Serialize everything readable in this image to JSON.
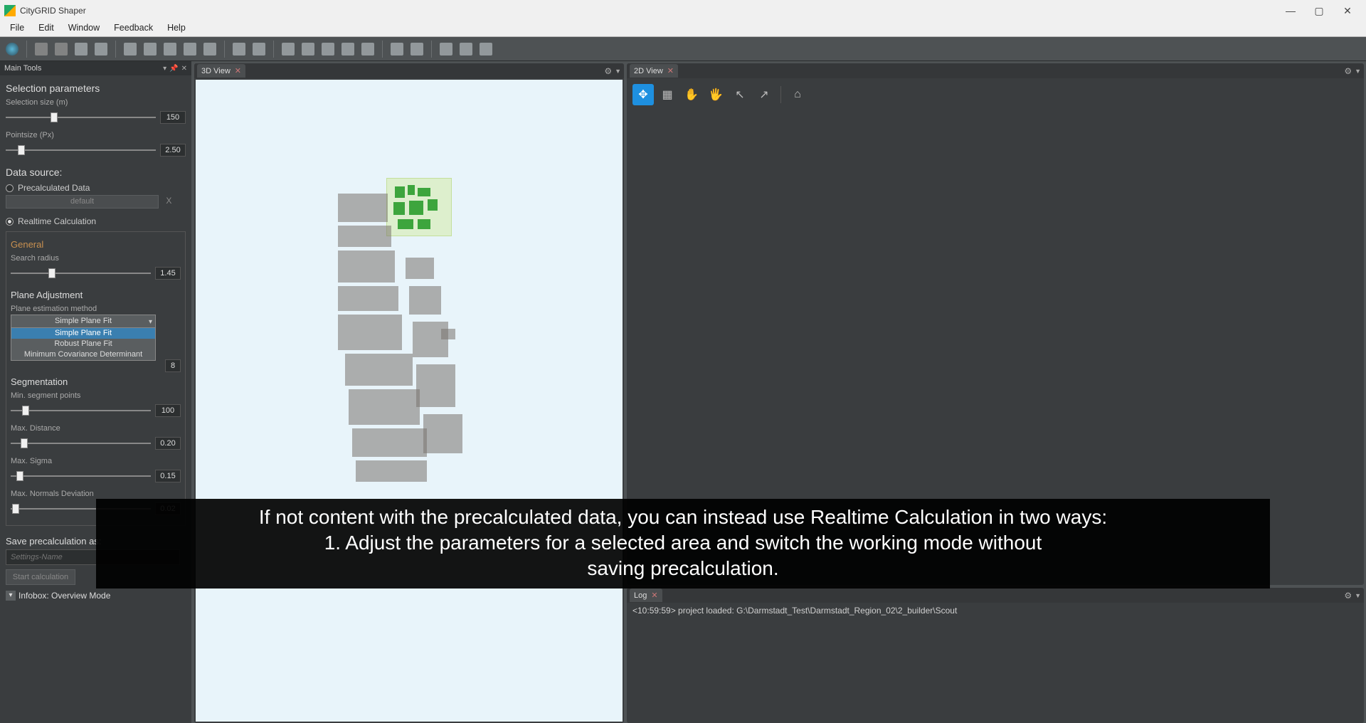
{
  "app": {
    "title": "CityGRID Shaper"
  },
  "menu": [
    "File",
    "Edit",
    "Window",
    "Feedback",
    "Help"
  ],
  "panel": {
    "title": "Main Tools",
    "selection_params": {
      "heading": "Selection parameters",
      "size_label": "Selection size (m)",
      "size_value": "150",
      "pointsize_label": "Pointsize (Px)",
      "pointsize_value": "2.50"
    },
    "data_source": {
      "heading": "Data source:",
      "precalc_label": "Precalculated Data",
      "precalc_combo": "default",
      "precalc_clear": "X",
      "realtime_label": "Realtime Calculation"
    },
    "general": {
      "heading": "General",
      "search_radius_label": "Search radius",
      "search_radius_value": "1.45"
    },
    "plane": {
      "heading": "Plane Adjustment",
      "method_label": "Plane estimation method",
      "combo_value": "Simple Plane Fit",
      "options": [
        "Simple Plane Fit",
        "Robust Plane Fit",
        "Minimum Covariance Determinant"
      ],
      "side_value": "8"
    },
    "segmentation": {
      "heading": "Segmentation",
      "min_pts_label": "Min. segment points",
      "min_pts_value": "100",
      "max_dist_label": "Max. Distance",
      "max_dist_value": "0.20",
      "max_sigma_label": "Max. Sigma",
      "max_sigma_value": "0.15",
      "max_norm_label": "Max. Normals Deviation",
      "max_norm_value": "0.02"
    },
    "save": {
      "heading": "Save precalculation as:",
      "placeholder": "Settings-Name",
      "button": "Start calculation"
    },
    "infobox": "Infobox: Overview Mode"
  },
  "views": {
    "tab3d": "3D View",
    "tab2d": "2D View",
    "logtab": "Log",
    "log_line": "<10:59:59> project loaded: G:\\Darmstadt_Test\\Darmstadt_Region_02\\2_builder\\Scout"
  },
  "subtitle": {
    "l1": "If not content with the precalculated data, you can instead use Realtime Calculation in two ways:",
    "l2": "1. Adjust the parameters for a selected area and switch the working mode without",
    "l3": "saving precalculation."
  }
}
